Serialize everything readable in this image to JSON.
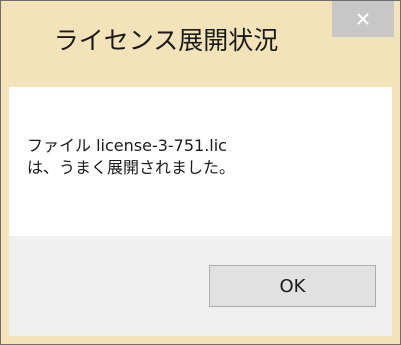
{
  "dialog": {
    "title": "ライセンス展開状況",
    "close_icon": "close-icon",
    "message_line1": "ファイル license-3-751.lic",
    "message_line2": "は、うまく展開されました。",
    "ok_label": "OK"
  },
  "colors": {
    "title_bar": "#f3e3b8",
    "close_button": "#c7c7c7",
    "content_bg": "#ffffff",
    "footer_bg": "#f0f0f0",
    "button_bg": "#e1e1e1",
    "button_border": "#adadad"
  }
}
